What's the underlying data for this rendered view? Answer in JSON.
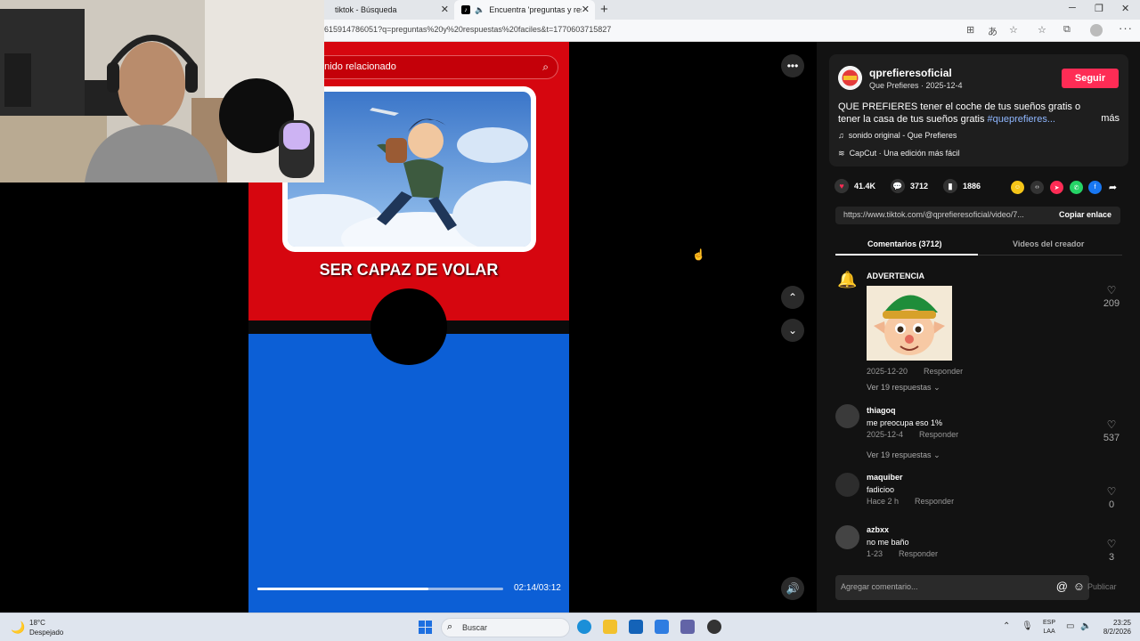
{
  "browser": {
    "tabs": [
      {
        "title": "tiktok - Búsqueda"
      },
      {
        "title": "Encuentra 'preguntas y resp"
      }
    ],
    "new_tab": "+",
    "url": "615914786051?q=preguntas%20y%20respuestas%20faciles&t=1770603715827",
    "window_controls": {
      "minimize": "─",
      "maximize": "❐",
      "close": "✕"
    }
  },
  "video": {
    "search_text": "enido relacionado",
    "caption": "SER CAPAZ DE VOLAR",
    "progress_fraction": 0.695,
    "time": "02:14/03:12"
  },
  "panel": {
    "channel": {
      "name": "qprefieresoficial",
      "subtitle": "Que Prefieres · 2025-12-4",
      "follow_label": "Seguir"
    },
    "description": {
      "text": "QUE PREFIERES tener el coche de tus sueños gratis o tener la casa de tus sueños gratis ",
      "hashtag": "#queprefieres...",
      "more": "más"
    },
    "music": "sonido original - Que Prefieres",
    "capcut": "CapCut · Una edición más fácil",
    "stats": {
      "likes": "41.4K",
      "comments": "3712",
      "saves": "1886"
    },
    "link": {
      "url": "https://www.tiktok.com/@qprefieresoficial/video/7...",
      "copy_label": "Copiar enlace"
    },
    "tabs": {
      "comments": "Comentarios (3712)",
      "creator_videos": "Videos del creador"
    },
    "comments": [
      {
        "user": "ADVERTENCIA",
        "text": "",
        "date": "2025-12-20",
        "reply": "Responder",
        "replies": "Ver 19 respuestas",
        "likes": "209"
      },
      {
        "user": "thiagoq",
        "text": "me preocupa eso 1%",
        "date": "2025-12-4",
        "reply": "Responder",
        "replies": "Ver 19 respuestas",
        "likes": "537"
      },
      {
        "user": "maquiber",
        "text": "fadicioo",
        "date": "Hace 2 h",
        "reply": "Responder",
        "likes": "0"
      },
      {
        "user": "azbxx",
        "text": "no me baño",
        "date": "1-23",
        "reply": "Responder",
        "likes": "3"
      }
    ],
    "composer": {
      "placeholder": "Agregar comentario...",
      "publish": "Publicar"
    }
  },
  "taskbar": {
    "weather_temp": "18°C",
    "weather_desc": "Despejado",
    "search_placeholder": "Buscar",
    "lang_top": "ESP",
    "lang_bottom": "LAA",
    "time": "23:25",
    "date": "8/2/2026"
  },
  "colors": {
    "follow": "#fe2c55",
    "video_red": "#d6060f",
    "video_blue": "#0c5fd6",
    "panel_bg": "#121212"
  }
}
